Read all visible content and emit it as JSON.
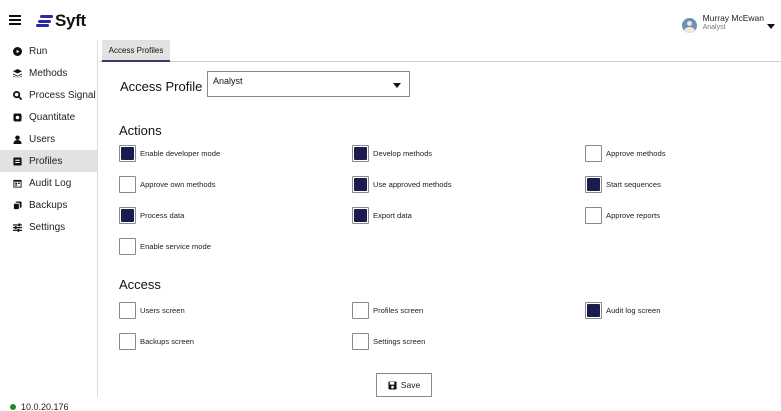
{
  "app": {
    "name": "Syft"
  },
  "user": {
    "name": "Murray McEwan",
    "role": "Analyst"
  },
  "sidebar": {
    "items": [
      {
        "label": "Run",
        "icon": "play-circle-icon",
        "active": false
      },
      {
        "label": "Methods",
        "icon": "layers-icon",
        "active": false
      },
      {
        "label": "Process Signal",
        "icon": "magnify-icon",
        "active": false
      },
      {
        "label": "Quantitate",
        "icon": "lock-box-icon",
        "active": false
      },
      {
        "label": "Users",
        "icon": "user-icon",
        "active": false
      },
      {
        "label": "Profiles",
        "icon": "id-card-icon",
        "active": true
      },
      {
        "label": "Audit Log",
        "icon": "calendar-icon",
        "active": false
      },
      {
        "label": "Backups",
        "icon": "copy-icon",
        "active": false
      },
      {
        "label": "Settings",
        "icon": "sliders-icon",
        "active": false
      }
    ],
    "ip_address": "10.0.20.176",
    "ip_status_color": "#1f8a2e"
  },
  "tabs": [
    {
      "label": "Access Profiles",
      "active": true
    }
  ],
  "profile": {
    "label": "Access Profile",
    "selected": "Analyst"
  },
  "actions": {
    "title": "Actions",
    "items": [
      {
        "label": "Enable developer mode",
        "checked": true
      },
      {
        "label": "Develop methods",
        "checked": true
      },
      {
        "label": "Approve methods",
        "checked": false
      },
      {
        "label": "Approve own methods",
        "checked": false
      },
      {
        "label": "Use approved methods",
        "checked": true
      },
      {
        "label": "Start sequences",
        "checked": true
      },
      {
        "label": "Process data",
        "checked": true
      },
      {
        "label": "Export data",
        "checked": true
      },
      {
        "label": "Approve reports",
        "checked": false
      },
      {
        "label": "Enable service mode",
        "checked": false
      }
    ]
  },
  "access": {
    "title": "Access",
    "items": [
      {
        "label": "Users screen",
        "checked": false
      },
      {
        "label": "Profiles screen",
        "checked": false
      },
      {
        "label": "Audit log screen",
        "checked": true
      },
      {
        "label": "Backups screen",
        "checked": false
      },
      {
        "label": "Settings screen",
        "checked": false
      }
    ]
  },
  "save_label": "Save",
  "colors": {
    "accent": "#2a2aa5",
    "checked_fill": "#1b1b4d",
    "active_nav_bg": "#e2e2e2"
  }
}
